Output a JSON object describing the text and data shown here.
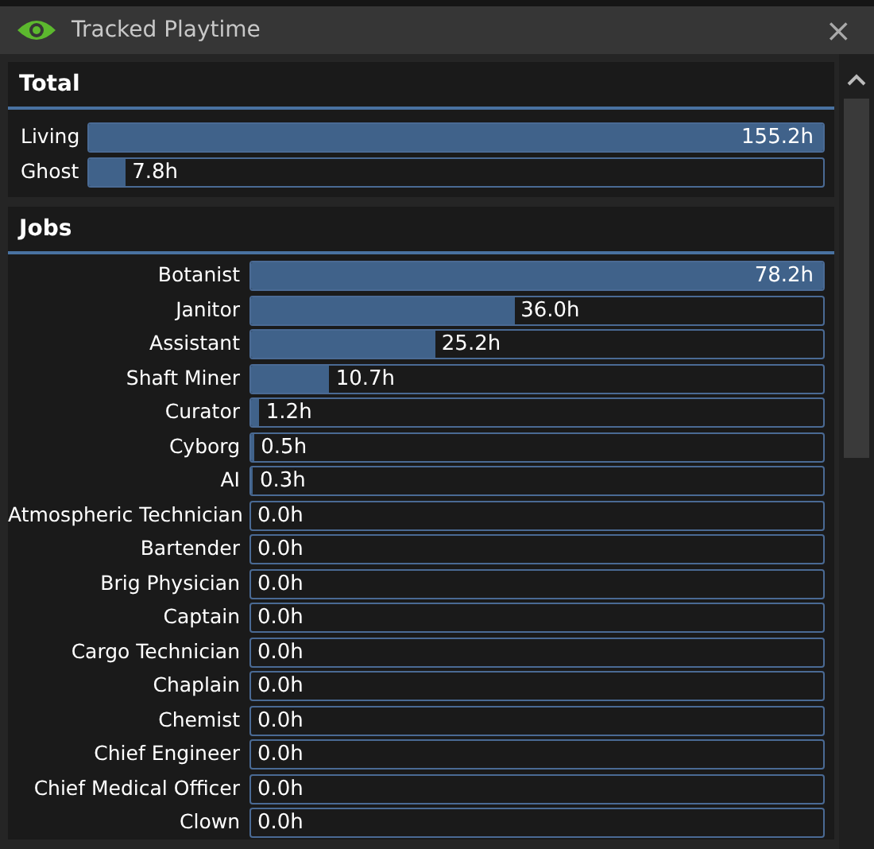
{
  "window": {
    "title": "Tracked Playtime",
    "close": "×"
  },
  "sections": [
    {
      "title": "Total",
      "kind": "total",
      "rows": [
        {
          "label": "Living",
          "level": 1.0,
          "reading": "155.2h"
        },
        {
          "label": "Ghost",
          "level": 0.05,
          "reading": "7.8h"
        }
      ]
    },
    {
      "title": "Jobs",
      "kind": "jobs",
      "rows": [
        {
          "label": "Botanist",
          "level": 1.0,
          "reading": "78.2h"
        },
        {
          "label": "Janitor",
          "level": 0.46,
          "reading": "36.0h"
        },
        {
          "label": "Assistant",
          "level": 0.322,
          "reading": "25.2h"
        },
        {
          "label": "Shaft Miner",
          "level": 0.137,
          "reading": "10.7h"
        },
        {
          "label": "Curator",
          "level": 0.015,
          "reading": "1.2h"
        },
        {
          "label": "Cyborg",
          "level": 0.006,
          "reading": "0.5h"
        },
        {
          "label": "AI",
          "level": 0.004,
          "reading": "0.3h"
        },
        {
          "label": "Atmospheric Technician",
          "level": 0,
          "reading": "0.0h"
        },
        {
          "label": "Bartender",
          "level": 0,
          "reading": "0.0h"
        },
        {
          "label": "Brig Physician",
          "level": 0,
          "reading": "0.0h"
        },
        {
          "label": "Captain",
          "level": 0,
          "reading": "0.0h"
        },
        {
          "label": "Cargo Technician",
          "level": 0,
          "reading": "0.0h"
        },
        {
          "label": "Chaplain",
          "level": 0,
          "reading": "0.0h"
        },
        {
          "label": "Chemist",
          "level": 0,
          "reading": "0.0h"
        },
        {
          "label": "Chief Engineer",
          "level": 0,
          "reading": "0.0h"
        },
        {
          "label": "Chief Medical Officer",
          "level": 0,
          "reading": "0.0h"
        },
        {
          "label": "Clown",
          "level": 0,
          "reading": "0.0h"
        }
      ]
    }
  ]
}
